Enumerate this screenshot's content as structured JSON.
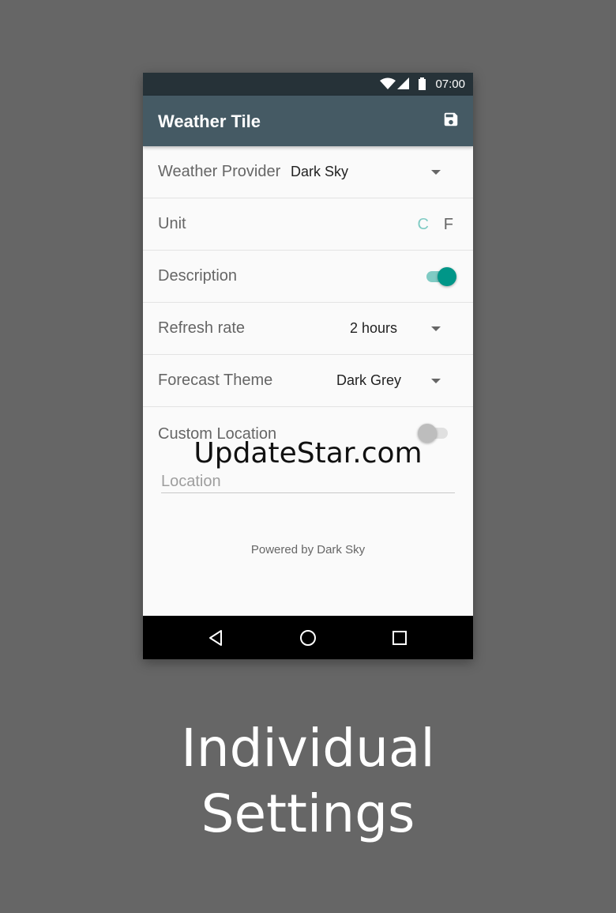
{
  "status_bar": {
    "time": "07:00",
    "icons": [
      "wifi-icon",
      "signal-icon",
      "battery-icon"
    ]
  },
  "app_bar": {
    "title": "Weather Tile",
    "action_icon": "save-icon"
  },
  "settings": {
    "weather_provider": {
      "label": "Weather Provider",
      "value": "Dark Sky"
    },
    "unit": {
      "label": "Unit",
      "option_c": "C",
      "option_f": "F",
      "selected": "C"
    },
    "description": {
      "label": "Description",
      "enabled": true
    },
    "refresh_rate": {
      "label": "Refresh rate",
      "value": "2 hours"
    },
    "forecast_theme": {
      "label": "Forecast Theme",
      "value": "Dark Grey"
    },
    "custom_location": {
      "label": "Custom Location",
      "enabled": false,
      "placeholder": "Location"
    }
  },
  "watermark": "UpdateStar.com",
  "footer": {
    "powered_by": "Powered by Dark Sky"
  },
  "nav_bar": {
    "icons": [
      "back-icon",
      "home-icon",
      "recents-icon"
    ]
  },
  "caption": {
    "line1": "Individual",
    "line2": "Settings"
  },
  "colors": {
    "status_bar": "#263238",
    "app_bar": "#455a64",
    "accent": "#009688",
    "background": "#666666"
  }
}
